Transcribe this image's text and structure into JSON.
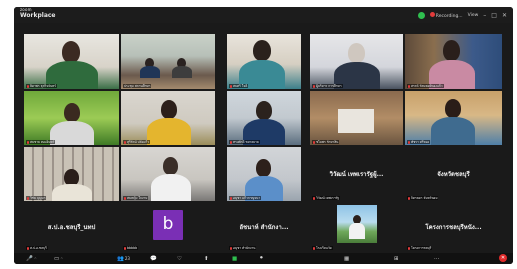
{
  "app": {
    "brand_top": "zoom",
    "brand_name": "Workplace"
  },
  "titlebar": {
    "recording_label": "Recording...",
    "view_label": "View",
    "minimize": "–",
    "maximize": "□",
    "close": "✕"
  },
  "tiles": [
    {
      "label": "ธิดาพร ธุรกิจจันทร์"
    },
    {
      "label": "ประชุม สถานศึกษา"
    },
    {
      "label": "สมศรี ใจดี"
    },
    {
      "label": "ผู้บริหาร การศึกษา"
    },
    {
      "label": "สรรค์ รัตนพงษ์ทองแก้ว"
    },
    {
      "label": "สมชาย ทองอินทร์"
    },
    {
      "label": "สุรีรัตน์ ปลั่งแก้ว"
    },
    {
      "label": "ทรงศักดิ์ ชยาธยาย"
    },
    {
      "label": "ชไมพร รักษาสิน"
    },
    {
      "label": "พัชรา ศรีทอง"
    },
    {
      "label": "วิชัย บุญมา"
    },
    {
      "label": "สมหญิง ใจงาม"
    },
    {
      "label": "อนุชา แก้วกาญจนา"
    },
    {
      "label": "ศุภชัย พูลสวัสดิ์"
    },
    {
      "label": "วิวัฒน์ เทพเรารัฐ"
    },
    {
      "label": "จิตรลดา จันทร์หอม"
    },
    {
      "label": "ส.ป.อ.ชลบุรี"
    },
    {
      "label": "bbbbb"
    },
    {
      "label": "อนุชา สำนักงาน"
    },
    {
      "label": "โรงเรียนวัด"
    },
    {
      "label": "โครงการชลบุรี"
    }
  ],
  "bignames": [
    "วิวัฒน์ เทพเรารัฐผู้...",
    "จังหวัดชลบุรี",
    "ส.ป.อ.ชลบุรี_นทป",
    "อัชนาห์ สำนักงา...",
    "โครงการชลบุรีหนัง..."
  ],
  "avatar_letter": "b",
  "toolbar": {
    "audio": "🎤",
    "video": "▭",
    "participants": "👥",
    "participants_count": "23",
    "chat": "💬",
    "react": "♡",
    "share": "⬆",
    "record": "⏺",
    "apps": "▦",
    "more": "⋯",
    "end": "✕"
  },
  "colors": {
    "active_speaker": "#37c15a",
    "avatar_purple": "#7a2fb5",
    "end_red": "#e02a2a"
  }
}
